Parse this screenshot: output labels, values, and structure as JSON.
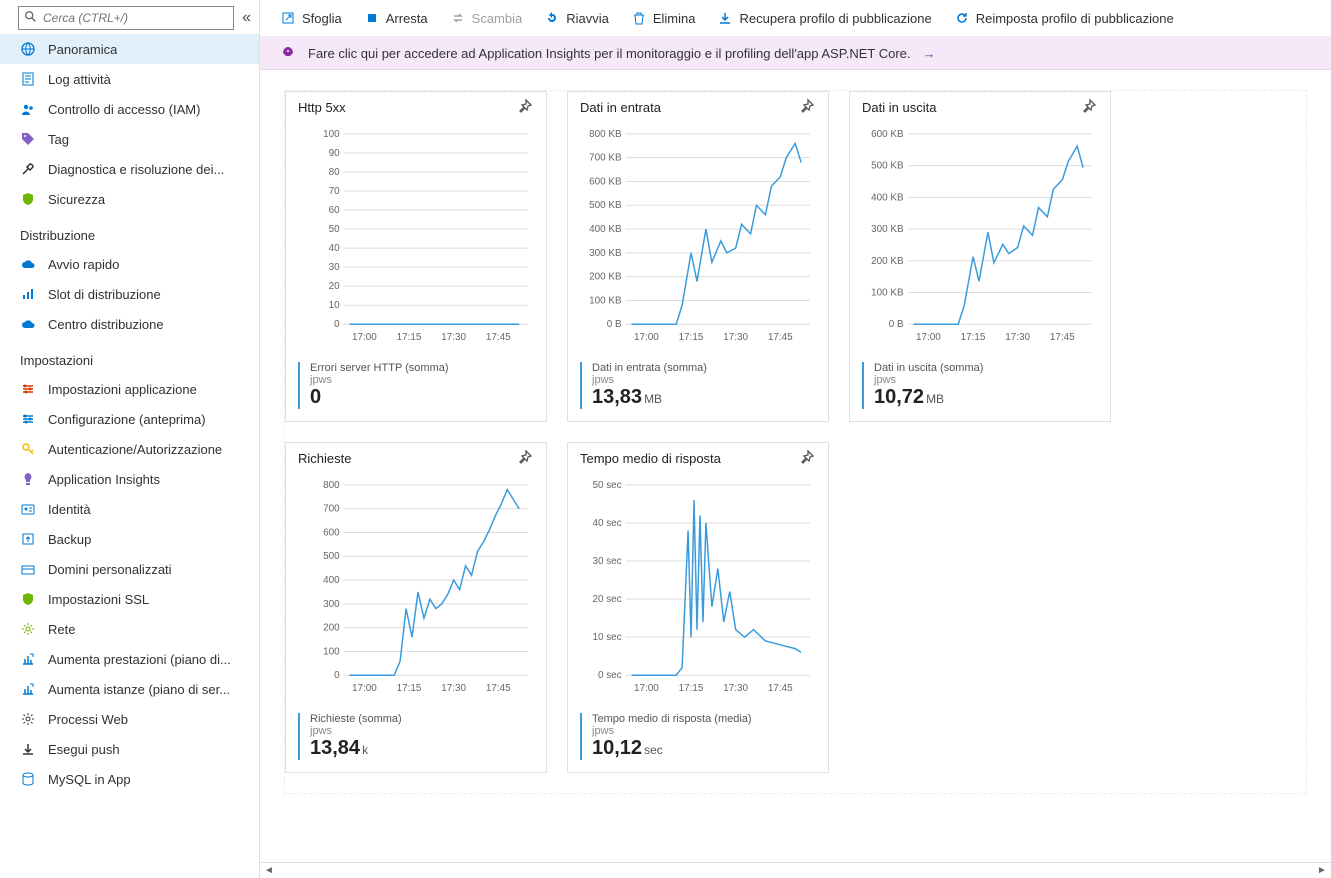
{
  "sidebar": {
    "search_placeholder": "Cerca (CTRL+/)",
    "items": [
      {
        "label": "Panoramica",
        "icon": "#i-globe",
        "fill": "#0078d4",
        "active": true
      },
      {
        "label": "Log attività",
        "icon": "#i-log",
        "fill": "#0078d4"
      },
      {
        "label": "Controllo di accesso (IAM)",
        "icon": "#i-people",
        "fill": "#0078d4"
      },
      {
        "label": "Tag",
        "icon": "#i-tag",
        "fill": "#8661c5"
      },
      {
        "label": "Diagnostica e risoluzione dei...",
        "icon": "#i-tools",
        "fill": "#333"
      },
      {
        "label": "Sicurezza",
        "icon": "#i-shield",
        "fill": "#6bb700"
      }
    ],
    "sections": [
      {
        "title": "Distribuzione",
        "items": [
          {
            "label": "Avvio rapido",
            "icon": "#i-cloud",
            "fill": "#0078d4"
          },
          {
            "label": "Slot di distribuzione",
            "icon": "#i-bars",
            "fill": "#0078d4"
          },
          {
            "label": "Centro distribuzione",
            "icon": "#i-cloud",
            "fill": "#0078d4"
          }
        ]
      },
      {
        "title": "Impostazioni",
        "items": [
          {
            "label": "Impostazioni applicazione",
            "icon": "#i-sliders",
            "fill": "#d83b01"
          },
          {
            "label": "Configurazione (anteprima)",
            "icon": "#i-sliders",
            "fill": "#0078d4"
          },
          {
            "label": "Autenticazione/Autorizzazione",
            "icon": "#i-key",
            "fill": "#ffb900"
          },
          {
            "label": "Application Insights",
            "icon": "#i-bulb",
            "fill": "#8661c5"
          },
          {
            "label": "Identità",
            "icon": "#i-id",
            "fill": "#0078d4"
          },
          {
            "label": "Backup",
            "icon": "#i-backup",
            "fill": "#0078d4"
          },
          {
            "label": "Domini personalizzati",
            "icon": "#i-domain",
            "fill": "#0078d4"
          },
          {
            "label": "Impostazioni SSL",
            "icon": "#i-shield",
            "fill": "#6bb700"
          },
          {
            "label": "Rete",
            "icon": "#i-net",
            "fill": "#6bb700"
          },
          {
            "label": "Aumenta prestazioni (piano di...",
            "icon": "#i-scale",
            "fill": "#0078d4"
          },
          {
            "label": "Aumenta istanze (piano di ser...",
            "icon": "#i-scale",
            "fill": "#0078d4"
          },
          {
            "label": "Processi Web",
            "icon": "#i-gear",
            "fill": "#333"
          },
          {
            "label": "Esegui push",
            "icon": "#i-push",
            "fill": "#333"
          },
          {
            "label": "MySQL in App",
            "icon": "#i-db",
            "fill": "#0078d4"
          }
        ]
      }
    ]
  },
  "toolbar": {
    "browse": "Sfoglia",
    "stop": "Arresta",
    "swap": "Scambia",
    "restart": "Riavvia",
    "delete": "Elimina",
    "getpub": "Recupera profilo di pubblicazione",
    "resetpub": "Reimposta profilo di pubblicazione"
  },
  "banner": {
    "text": "Fare clic qui per accedere ad Application Insights per il monitoraggio e il profiling dell'app ASP.NET Core."
  },
  "cards": [
    {
      "id": "http5xx",
      "title": "Http 5xx",
      "metric_label": "Errori server HTTP (somma)",
      "metric_sub": "jpws",
      "metric_value": "0",
      "metric_unit": ""
    },
    {
      "id": "datain",
      "title": "Dati in entrata",
      "metric_label": "Dati in entrata (somma)",
      "metric_sub": "jpws",
      "metric_value": "13,83",
      "metric_unit": "MB"
    },
    {
      "id": "dataout",
      "title": "Dati in uscita",
      "metric_label": "Dati in uscita (somma)",
      "metric_sub": "jpws",
      "metric_value": "10,72",
      "metric_unit": "MB"
    },
    {
      "id": "requests",
      "title": "Richieste",
      "metric_label": "Richieste (somma)",
      "metric_sub": "jpws",
      "metric_value": "13,84",
      "metric_unit": "k"
    },
    {
      "id": "resptime",
      "title": "Tempo medio di risposta",
      "metric_label": "Tempo medio di risposta (media)",
      "metric_sub": "jpws",
      "metric_value": "10,12",
      "metric_unit": "sec"
    }
  ],
  "chart_data": [
    {
      "id": "http5xx",
      "type": "line",
      "x_ticks": [
        "17:00",
        "17:15",
        "17:30",
        "17:45"
      ],
      "y_ticks": [
        0,
        10,
        20,
        30,
        40,
        50,
        60,
        70,
        80,
        90,
        100
      ],
      "ylim": [
        0,
        100
      ],
      "series": [
        {
          "name": "Errori server HTTP",
          "x": [
            "16:55",
            "17:00",
            "17:15",
            "17:30",
            "17:45",
            "17:52"
          ],
          "y": [
            0,
            0,
            0,
            0,
            0,
            0
          ]
        }
      ]
    },
    {
      "id": "datain",
      "type": "line",
      "x_ticks": [
        "17:00",
        "17:15",
        "17:30",
        "17:45"
      ],
      "y_ticks": [
        "0 B",
        "100 KB",
        "200 KB",
        "300 KB",
        "400 KB",
        "500 KB",
        "600 KB",
        "700 KB",
        "800 KB"
      ],
      "ylim": [
        0,
        800
      ],
      "series": [
        {
          "name": "Dati in entrata",
          "x": [
            "16:55",
            "17:00",
            "17:05",
            "17:10",
            "17:12",
            "17:15",
            "17:17",
            "17:20",
            "17:22",
            "17:25",
            "17:27",
            "17:30",
            "17:32",
            "17:35",
            "17:37",
            "17:40",
            "17:42",
            "17:45",
            "17:47",
            "17:50",
            "17:52"
          ],
          "y": [
            0,
            0,
            0,
            0,
            80,
            300,
            180,
            400,
            260,
            350,
            300,
            320,
            420,
            380,
            500,
            460,
            580,
            620,
            700,
            760,
            680
          ]
        }
      ]
    },
    {
      "id": "dataout",
      "type": "line",
      "x_ticks": [
        "17:00",
        "17:15",
        "17:30",
        "17:45"
      ],
      "y_ticks": [
        "0 B",
        "100 KB",
        "200 KB",
        "300 KB",
        "400 KB",
        "500 KB",
        "600 KB"
      ],
      "ylim": [
        0,
        620
      ],
      "series": [
        {
          "name": "Dati in uscita",
          "x": [
            "16:55",
            "17:00",
            "17:05",
            "17:10",
            "17:12",
            "17:15",
            "17:17",
            "17:20",
            "17:22",
            "17:25",
            "17:27",
            "17:30",
            "17:32",
            "17:35",
            "17:37",
            "17:40",
            "17:42",
            "17:45",
            "17:47",
            "17:50",
            "17:52"
          ],
          "y": [
            0,
            0,
            0,
            0,
            60,
            220,
            140,
            300,
            200,
            260,
            230,
            250,
            320,
            290,
            380,
            350,
            440,
            470,
            530,
            580,
            510
          ]
        }
      ]
    },
    {
      "id": "requests",
      "type": "line",
      "x_ticks": [
        "17:00",
        "17:15",
        "17:30",
        "17:45"
      ],
      "y_ticks": [
        0,
        100,
        200,
        300,
        400,
        500,
        600,
        700,
        800
      ],
      "ylim": [
        0,
        800
      ],
      "series": [
        {
          "name": "Richieste",
          "x": [
            "16:55",
            "17:00",
            "17:05",
            "17:10",
            "17:12",
            "17:14",
            "17:16",
            "17:18",
            "17:20",
            "17:22",
            "17:24",
            "17:26",
            "17:28",
            "17:30",
            "17:32",
            "17:34",
            "17:36",
            "17:38",
            "17:40",
            "17:42",
            "17:44",
            "17:46",
            "17:48",
            "17:50",
            "17:52"
          ],
          "y": [
            0,
            0,
            0,
            0,
            60,
            280,
            160,
            350,
            240,
            320,
            280,
            300,
            340,
            400,
            360,
            460,
            420,
            520,
            560,
            610,
            670,
            720,
            780,
            740,
            700
          ]
        }
      ]
    },
    {
      "id": "resptime",
      "type": "line",
      "x_ticks": [
        "17:00",
        "17:15",
        "17:30",
        "17:45"
      ],
      "y_ticks": [
        "0 sec",
        "10 sec",
        "20 sec",
        "30 sec",
        "40 sec",
        "50 sec"
      ],
      "ylim": [
        0,
        50
      ],
      "series": [
        {
          "name": "Tempo medio di risposta",
          "x": [
            "16:55",
            "17:00",
            "17:05",
            "17:10",
            "17:12",
            "17:14",
            "17:15",
            "17:16",
            "17:17",
            "17:18",
            "17:19",
            "17:20",
            "17:22",
            "17:24",
            "17:26",
            "17:28",
            "17:30",
            "17:33",
            "17:36",
            "17:40",
            "17:45",
            "17:50",
            "17:52"
          ],
          "y": [
            0,
            0,
            0,
            0,
            2,
            38,
            10,
            46,
            12,
            42,
            14,
            40,
            18,
            28,
            14,
            22,
            12,
            10,
            12,
            9,
            8,
            7,
            6
          ]
        }
      ]
    }
  ]
}
